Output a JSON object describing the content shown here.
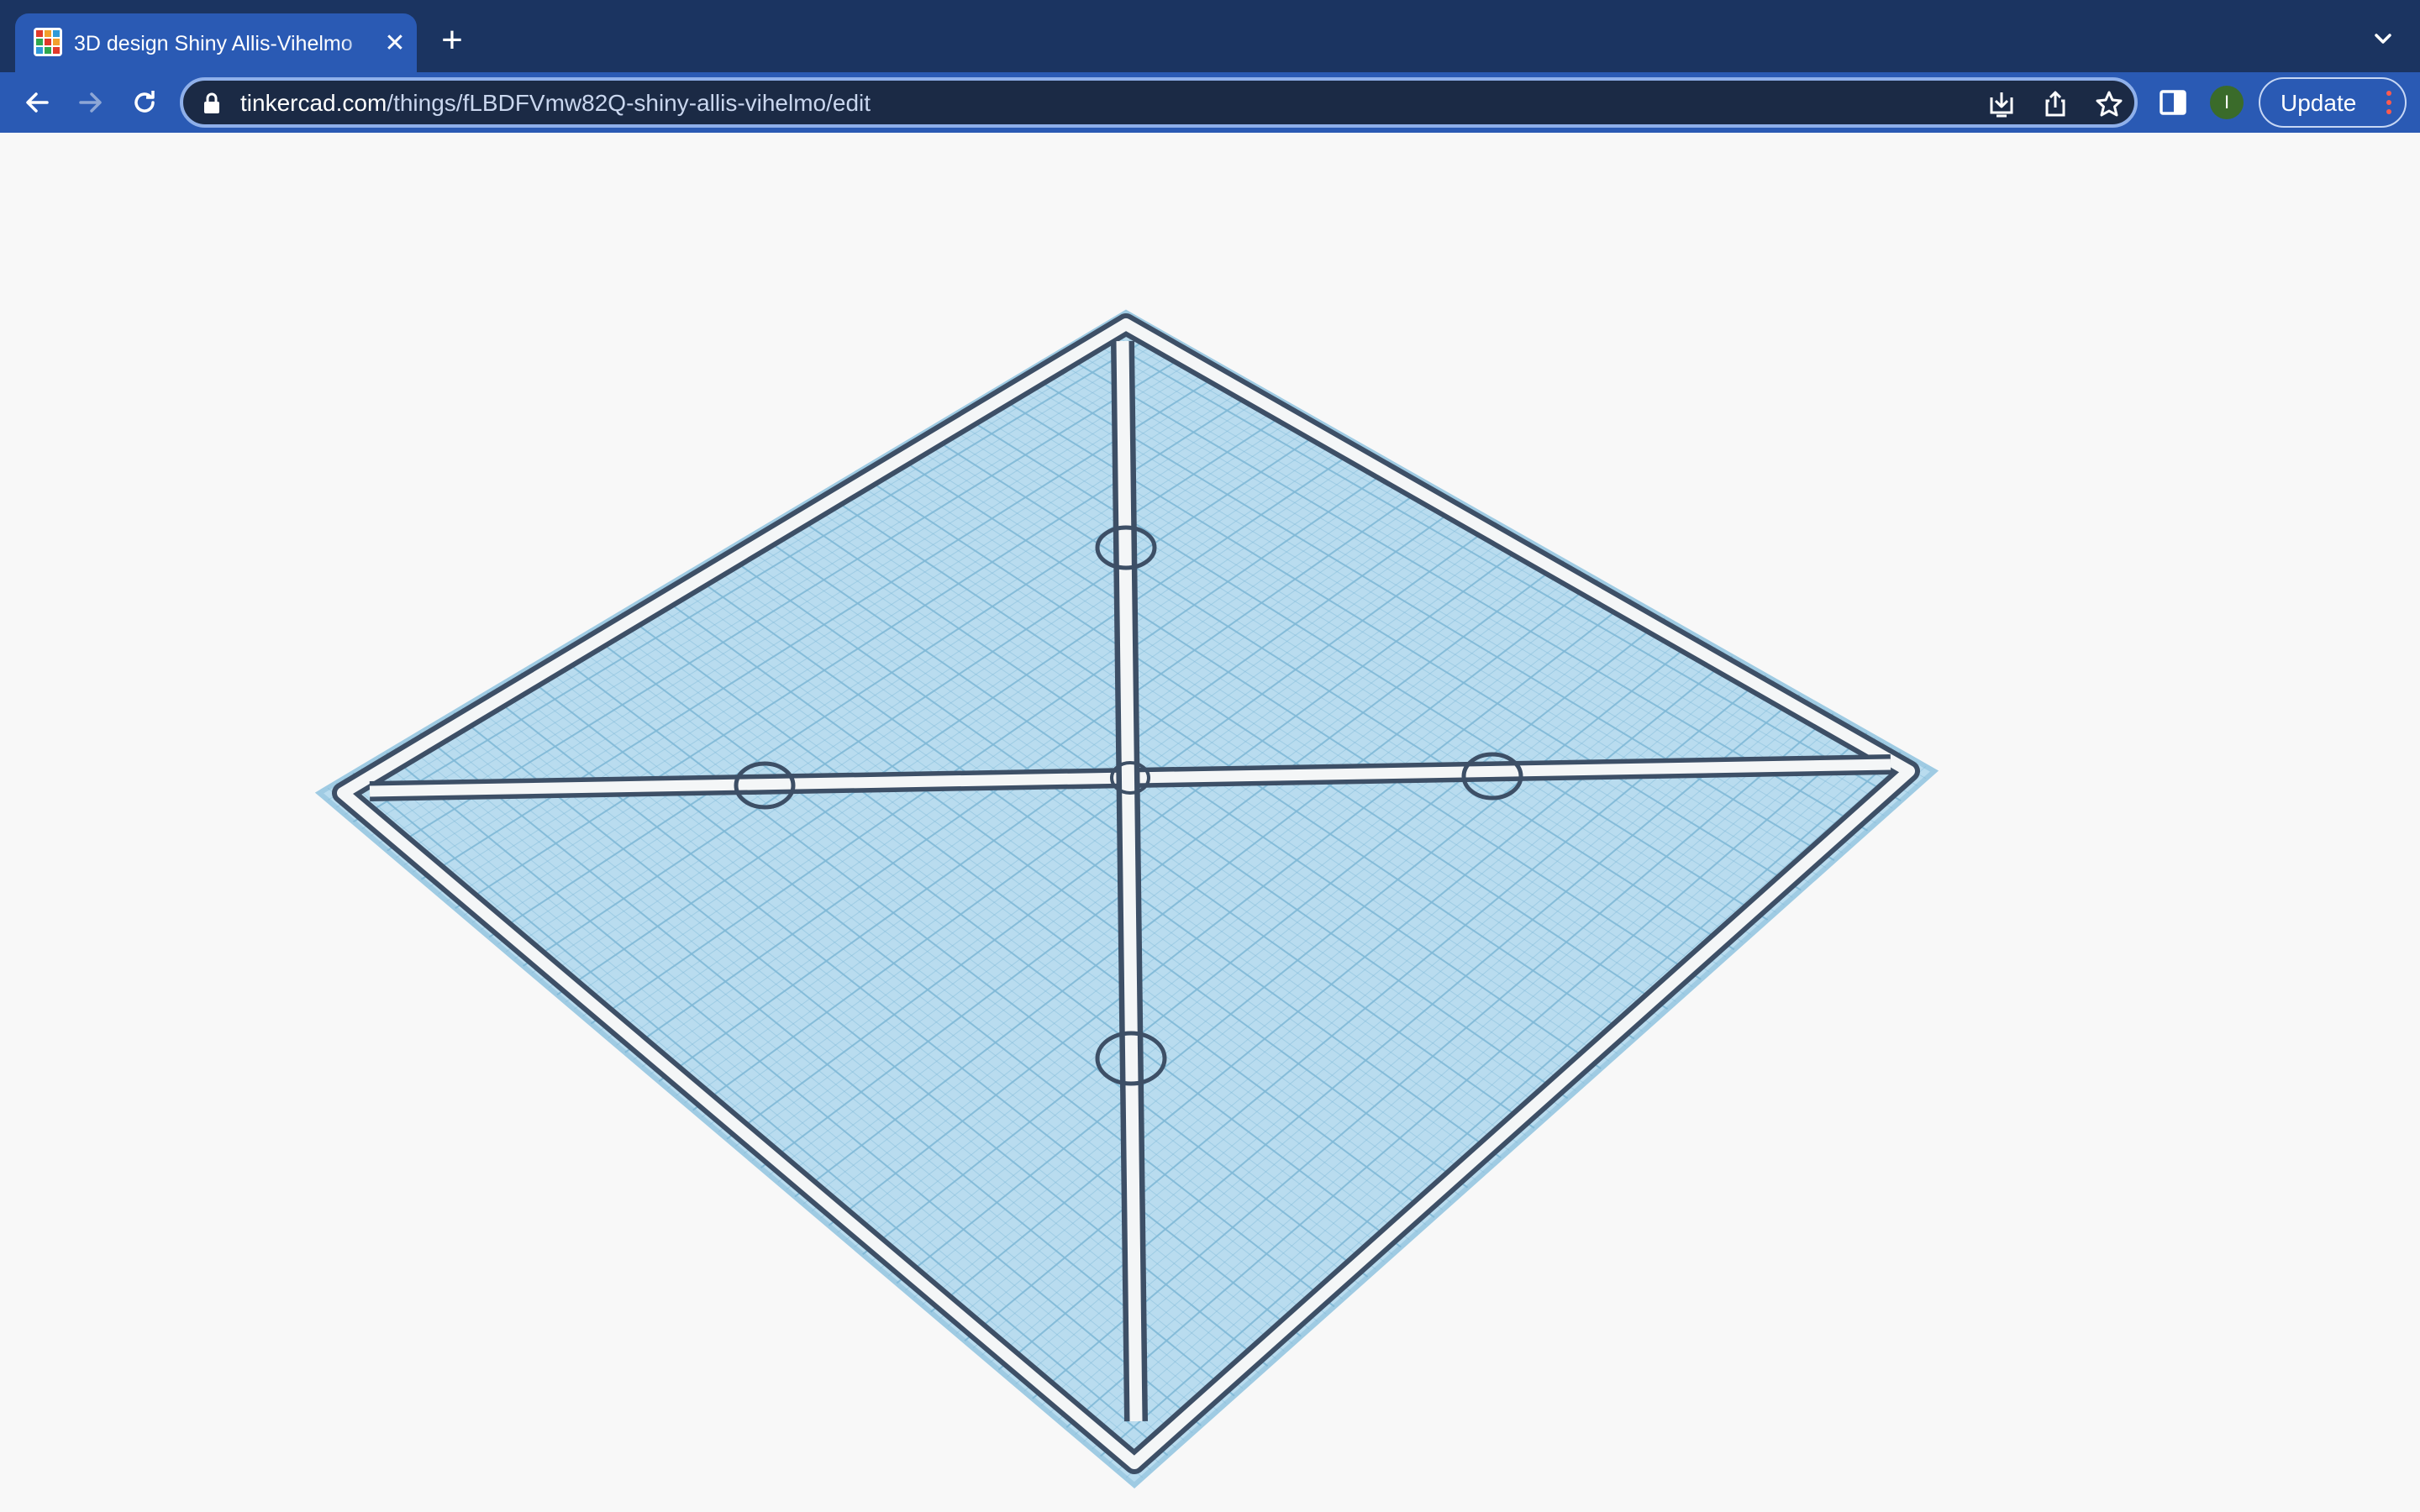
{
  "tab": {
    "title": "3D design Shiny Allis-Vihelmo",
    "close_glyph": "✕",
    "favicon": "tinkercad-logo-icon"
  },
  "new_tab_glyph": "+",
  "address_bar": {
    "host": "tinkercad.com",
    "path": "/things/fLBDFVmw82Q-shiny-allis-vihelmo/edit"
  },
  "toolbar": {
    "update_label": "Update",
    "profile_initial": "I",
    "icons": [
      "back-arrow-icon",
      "forward-arrow-icon",
      "reload-icon",
      "lock-icon",
      "install-app-icon",
      "share-icon",
      "bookmark-star-icon",
      "side-panel-icon",
      "chevron-down-icon",
      "kebab-menu-icon"
    ]
  },
  "colors": {
    "tabstrip": "#1b3461",
    "active_tab": "#2a5ab4",
    "omnibox": "#1b2a45",
    "workplane_fill": "#b9dcef",
    "grid_line": "#7fb8d6",
    "frame_outline": "#3d4f66",
    "frame_fill": "#f4f6f7",
    "background": "#f8f8f8"
  },
  "workplane": {
    "description_icon": "workplane-grid",
    "grid_divisions": 24
  }
}
